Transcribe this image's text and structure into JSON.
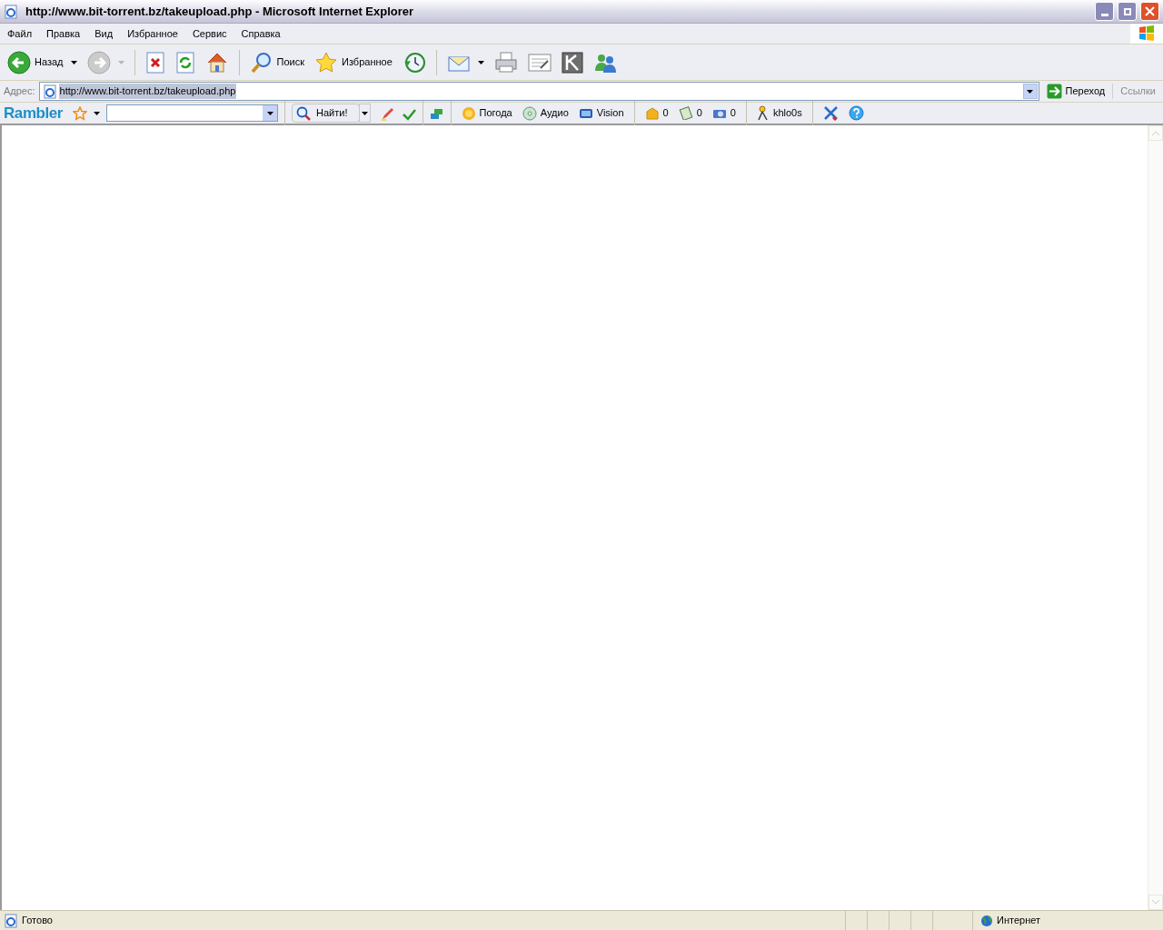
{
  "window": {
    "title": "http://www.bit-torrent.bz/takeupload.php - Microsoft Internet Explorer"
  },
  "menu": [
    "Файл",
    "Правка",
    "Вид",
    "Избранное",
    "Сервис",
    "Справка"
  ],
  "toolbar": [
    {
      "kind": "back",
      "label": "Назад",
      "dropdown": true,
      "disabled": false
    },
    {
      "kind": "forward",
      "dropdown": true,
      "disabled": true
    },
    {
      "kind": "sep"
    },
    {
      "kind": "stop"
    },
    {
      "kind": "refresh"
    },
    {
      "kind": "home"
    },
    {
      "kind": "sep"
    },
    {
      "kind": "search",
      "label": "Поиск"
    },
    {
      "kind": "favorites",
      "label": "Избранное"
    },
    {
      "kind": "history"
    },
    {
      "kind": "sep"
    },
    {
      "kind": "mail",
      "dropdown": true
    },
    {
      "kind": "print"
    },
    {
      "kind": "edit"
    },
    {
      "kind": "k"
    },
    {
      "kind": "messenger"
    }
  ],
  "address": {
    "label": "Адрес:",
    "value": "http://www.bit-torrent.bz/takeupload.php",
    "text_selected": true,
    "go": "Переход",
    "links": "Ссылки"
  },
  "rambler": {
    "logo": "Rambler",
    "search_button": "Найти!",
    "items": [
      {
        "kind": "weather",
        "label": "Погода"
      },
      {
        "kind": "audio",
        "label": "Аудио"
      },
      {
        "kind": "vision",
        "label": "Vision"
      },
      {
        "kind": "sep"
      },
      {
        "kind": "mail",
        "label": "0"
      },
      {
        "kind": "note",
        "label": "0"
      },
      {
        "kind": "photo",
        "label": "0"
      },
      {
        "kind": "sep"
      },
      {
        "kind": "user",
        "label": "khlo0s"
      },
      {
        "kind": "sep"
      },
      {
        "kind": "tools"
      },
      {
        "kind": "help"
      }
    ]
  },
  "status_bar": {
    "text": "Готово",
    "zone": "Интернет"
  }
}
